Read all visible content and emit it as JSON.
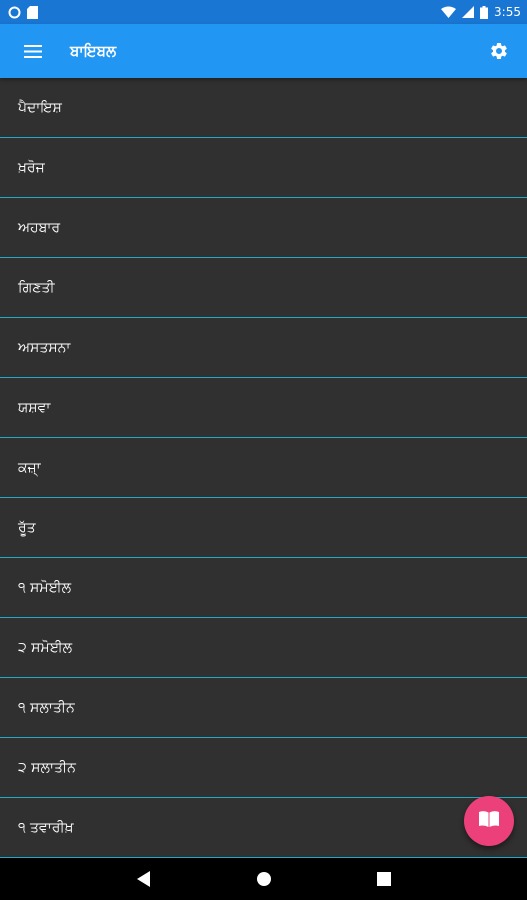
{
  "status_bar": {
    "time": "3:55",
    "left_icons": [
      "notification-circle-icon",
      "sd-card-icon"
    ],
    "right_icons": [
      "wifi-icon",
      "cell-signal-icon",
      "battery-icon"
    ]
  },
  "app_bar": {
    "title": "ਬਾਇਬਲ",
    "menu_icon": "hamburger-menu-icon",
    "settings_icon": "gear-icon"
  },
  "books": [
    "ਪੈਦਾਇਸ਼",
    "ਖ਼ਰੋਜ",
    "ਅਹਬਾਰ",
    "ਗਿਣਤੀ",
    "ਅਸਤਸਨਾ",
    "ਯਸ਼ਵਾ",
    "ਕਜ਼ਾ੍",
    "ਰੂੱਤ",
    "੧ ਸਮੋਈਲ",
    "੨ ਸਮੋਈਲ",
    "੧ ਸਲਾਤੀਨ",
    "੨ ਸਲਾਤੀਨ",
    "੧ ਤਵਾਰੀਖ਼"
  ],
  "fab": {
    "icon": "open-book-icon"
  },
  "nav_bar": {
    "icons": [
      "back-icon",
      "home-icon",
      "recents-icon"
    ]
  },
  "colors": {
    "status_bar": "#1976D2",
    "app_bar": "#2196F3",
    "background": "#303030",
    "divider": "#26A8C4",
    "fab": "#EC407A"
  }
}
